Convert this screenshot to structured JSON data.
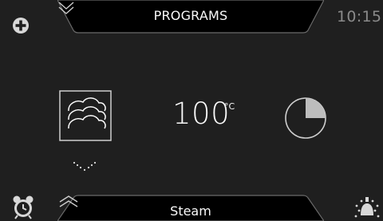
{
  "header": {
    "title": "PROGRAMS",
    "clock": "10:15"
  },
  "main": {
    "temperature": "100",
    "temperature_unit": "°C",
    "timer_progress": 0.25
  },
  "footer": {
    "mode_label": "Steam"
  },
  "icons": {
    "add": "plus-circle-icon",
    "top_toggle": "chevron-double-down-icon",
    "mode": "steam-clouds-icon",
    "mode_select": "chevron-down-dotted-icon",
    "timer": "pie-timer-icon",
    "bottom_toggle": "chevron-double-up-icon",
    "alarm": "alarm-clock-icon",
    "light": "light-bulb-icon"
  },
  "colors": {
    "background": "#1f1f1f",
    "tab_fill": "#000000",
    "tab_border": "#6a6a6a",
    "accent_grey": "#bdbdbd",
    "clock": "#8a8a8a"
  }
}
